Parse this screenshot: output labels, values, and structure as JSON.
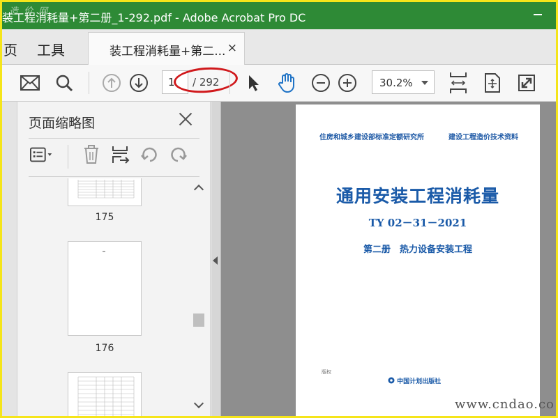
{
  "window": {
    "title": "装工程消耗量+第二册_1-292.pdf - Adobe Acrobat Pro DC",
    "watermark": "造 价 网"
  },
  "menu": {
    "home_label": "页",
    "tools_label": "工具"
  },
  "tab": {
    "label": "装工程消耗量+第二...",
    "close_glyph": "×"
  },
  "toolbar": {
    "current_page": "1",
    "total_pages": "/ 292",
    "zoom": "30.2%"
  },
  "thumbnails_panel": {
    "title": "页面缩略图",
    "thumbnails": [
      {
        "label": "175"
      },
      {
        "label": "176"
      },
      {
        "label": ""
      }
    ]
  },
  "document": {
    "header_left": "住房和城乡建设部标准定额研究所",
    "header_right": "建设工程造价技术资料",
    "title": "通用安装工程消耗量",
    "code": "TY 02－31－2021",
    "volume": "第二册　热力设备安装工程",
    "small_text": "版权",
    "publisher": "中国计划出版社"
  },
  "footer_watermark": "www.cndao.co",
  "colors": {
    "titlebar": "#2e8a36",
    "border": "#f5e51a",
    "accent_blue": "#1a5aa8",
    "annotation_red": "#d0191c",
    "hand_tool_blue": "#1f73c6"
  }
}
